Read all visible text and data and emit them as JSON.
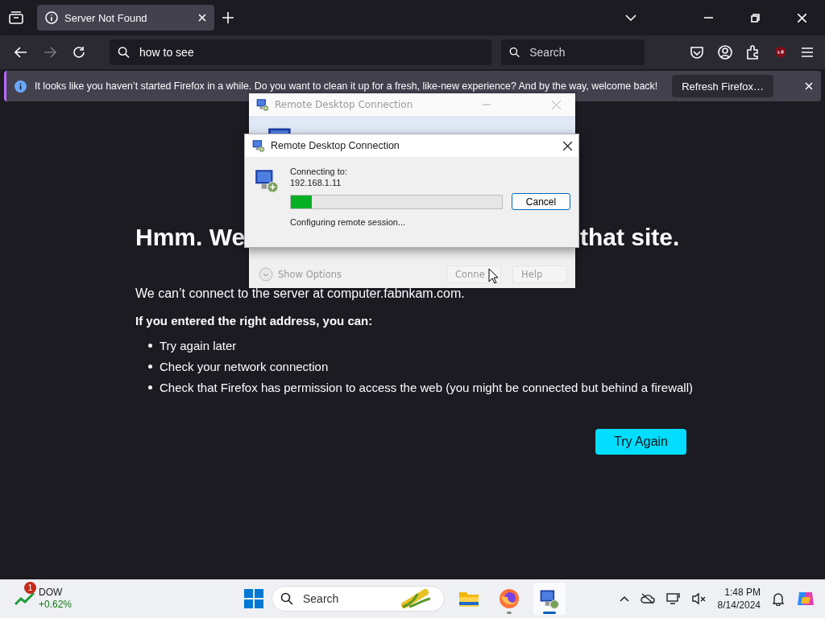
{
  "browser": {
    "tabs": [
      {
        "title": "Server Not Found",
        "selected": true
      }
    ],
    "address": "how to see",
    "search_placeholder": "Search"
  },
  "notification": {
    "message": "It looks like you haven’t started Firefox in a while. Do you want to clean it up for a fresh, like-new experience? And by the way, welcome back!",
    "button": "Refresh Firefox…"
  },
  "error_page": {
    "heading_start": "Hmm. We",
    "heading_end": "that site.",
    "message": "We can’t connect to the server at computer.fabnkam.com.",
    "subheading": "If you entered the right address, you can:",
    "suggestions": [
      "Try again later",
      "Check your network connection",
      "Check that Firefox has permission to access the web (you might be connected but behind a firewall)"
    ],
    "button": "Try Again"
  },
  "back_dialog": {
    "title": "Remote Desktop Connection",
    "show_options": "Show Options",
    "buttons": [
      "Conne",
      "Help"
    ]
  },
  "dialog": {
    "title": "Remote Desktop Connection",
    "label": "Connecting to:",
    "address": "192.168.1.11",
    "level": 0.1,
    "button": "Cancel",
    "status": "Configuring remote session..."
  },
  "taskbar": {
    "stock": {
      "badge": "1",
      "name": "DOW",
      "change": "+0.62%"
    },
    "search_placeholder": "Search",
    "apps": [
      {
        "kind": "folder",
        "running": false,
        "selected": false
      },
      {
        "kind": "firefox",
        "running": true,
        "selected": false
      },
      {
        "kind": "remote-desktop",
        "running": true,
        "selected": true
      }
    ],
    "time": "1:48 PM",
    "date": "8/14/2024"
  }
}
